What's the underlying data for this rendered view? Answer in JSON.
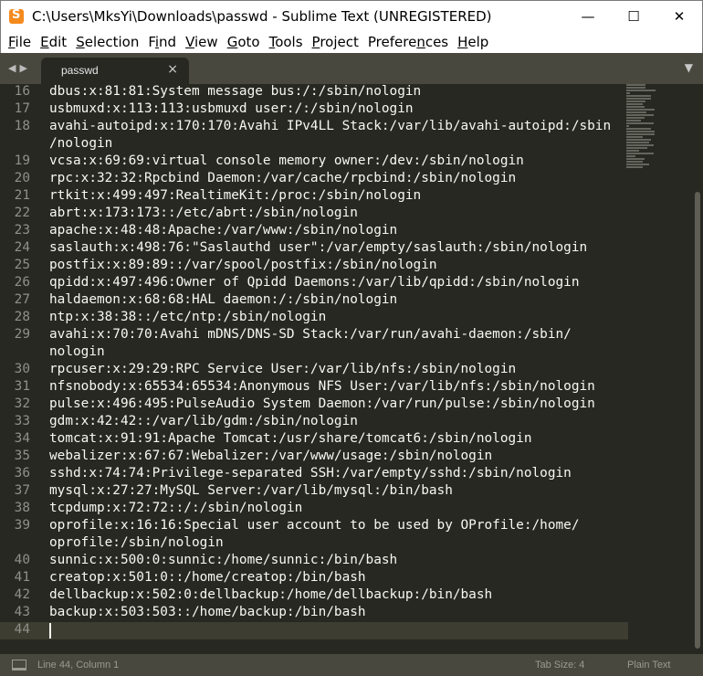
{
  "window": {
    "title": "C:\\Users\\MksYi\\Downloads\\passwd - Sublime Text (UNREGISTERED)",
    "app_icon": "sublime-text-icon",
    "controls": {
      "minimize": "—",
      "maximize": "☐",
      "close": "✕"
    }
  },
  "menu": [
    {
      "pre": "",
      "u": "F",
      "post": "ile"
    },
    {
      "pre": "",
      "u": "E",
      "post": "dit"
    },
    {
      "pre": "",
      "u": "S",
      "post": "election"
    },
    {
      "pre": "F",
      "u": "i",
      "post": "nd"
    },
    {
      "pre": "",
      "u": "V",
      "post": "iew"
    },
    {
      "pre": "",
      "u": "G",
      "post": "oto"
    },
    {
      "pre": "",
      "u": "T",
      "post": "ools"
    },
    {
      "pre": "",
      "u": "P",
      "post": "roject"
    },
    {
      "pre": "Prefere",
      "u": "n",
      "post": "ces"
    },
    {
      "pre": "",
      "u": "H",
      "post": "elp"
    }
  ],
  "tabs": {
    "nav_arrows": "◀▶",
    "active_tab": "passwd",
    "close_glyph": "×",
    "dropdown_glyph": "▼"
  },
  "editor": {
    "colors": {
      "background": "#272822",
      "text": "#f8f8f2",
      "gutter": "#90908a",
      "current_line": "#3e3d32"
    },
    "lines": [
      {
        "n": "16",
        "text": "dbus:x:81:81:System message bus:/:/sbin/nologin"
      },
      {
        "n": "17",
        "text": "usbmuxd:x:113:113:usbmuxd user:/:/sbin/nologin"
      },
      {
        "n": "18",
        "text": "avahi-autoipd:x:170:170:Avahi IPv4LL Stack:/var/lib/avahi-autoipd:/sbin"
      },
      {
        "n": "",
        "text": "/nologin"
      },
      {
        "n": "19",
        "text": "vcsa:x:69:69:virtual console memory owner:/dev:/sbin/nologin"
      },
      {
        "n": "20",
        "text": "rpc:x:32:32:Rpcbind Daemon:/var/cache/rpcbind:/sbin/nologin"
      },
      {
        "n": "21",
        "text": "rtkit:x:499:497:RealtimeKit:/proc:/sbin/nologin"
      },
      {
        "n": "22",
        "text": "abrt:x:173:173::/etc/abrt:/sbin/nologin"
      },
      {
        "n": "23",
        "text": "apache:x:48:48:Apache:/var/www:/sbin/nologin"
      },
      {
        "n": "24",
        "text": "saslauth:x:498:76:\"Saslauthd user\":/var/empty/saslauth:/sbin/nologin"
      },
      {
        "n": "25",
        "text": "postfix:x:89:89::/var/spool/postfix:/sbin/nologin"
      },
      {
        "n": "26",
        "text": "qpidd:x:497:496:Owner of Qpidd Daemons:/var/lib/qpidd:/sbin/nologin"
      },
      {
        "n": "27",
        "text": "haldaemon:x:68:68:HAL daemon:/:/sbin/nologin"
      },
      {
        "n": "28",
        "text": "ntp:x:38:38::/etc/ntp:/sbin/nologin"
      },
      {
        "n": "29",
        "text": "avahi:x:70:70:Avahi mDNS/DNS-SD Stack:/var/run/avahi-daemon:/sbin/"
      },
      {
        "n": "",
        "text": "nologin"
      },
      {
        "n": "30",
        "text": "rpcuser:x:29:29:RPC Service User:/var/lib/nfs:/sbin/nologin"
      },
      {
        "n": "31",
        "text": "nfsnobody:x:65534:65534:Anonymous NFS User:/var/lib/nfs:/sbin/nologin"
      },
      {
        "n": "32",
        "text": "pulse:x:496:495:PulseAudio System Daemon:/var/run/pulse:/sbin/nologin"
      },
      {
        "n": "33",
        "text": "gdm:x:42:42::/var/lib/gdm:/sbin/nologin"
      },
      {
        "n": "34",
        "text": "tomcat:x:91:91:Apache Tomcat:/usr/share/tomcat6:/sbin/nologin"
      },
      {
        "n": "35",
        "text": "webalizer:x:67:67:Webalizer:/var/www/usage:/sbin/nologin"
      },
      {
        "n": "36",
        "text": "sshd:x:74:74:Privilege-separated SSH:/var/empty/sshd:/sbin/nologin"
      },
      {
        "n": "37",
        "text": "mysql:x:27:27:MySQL Server:/var/lib/mysql:/bin/bash"
      },
      {
        "n": "38",
        "text": "tcpdump:x:72:72::/:/sbin/nologin"
      },
      {
        "n": "39",
        "text": "oprofile:x:16:16:Special user account to be used by OProfile:/home/"
      },
      {
        "n": "",
        "text": "oprofile:/sbin/nologin"
      },
      {
        "n": "40",
        "text": "sunnic:x:500:0:sunnic:/home/sunnic:/bin/bash"
      },
      {
        "n": "41",
        "text": "creatop:x:501:0::/home/creatop:/bin/bash"
      },
      {
        "n": "42",
        "text": "dellbackup:x:502:0:dellbackup:/home/dellbackup:/bin/bash"
      },
      {
        "n": "43",
        "text": "backup:x:503:503::/home/backup:/bin/bash"
      },
      {
        "n": "44",
        "text": ""
      }
    ],
    "current_line_number": "44"
  },
  "statusbar": {
    "position": "Line 44, Column 1",
    "tab_size": "Tab Size: 4",
    "syntax": "Plain Text"
  }
}
